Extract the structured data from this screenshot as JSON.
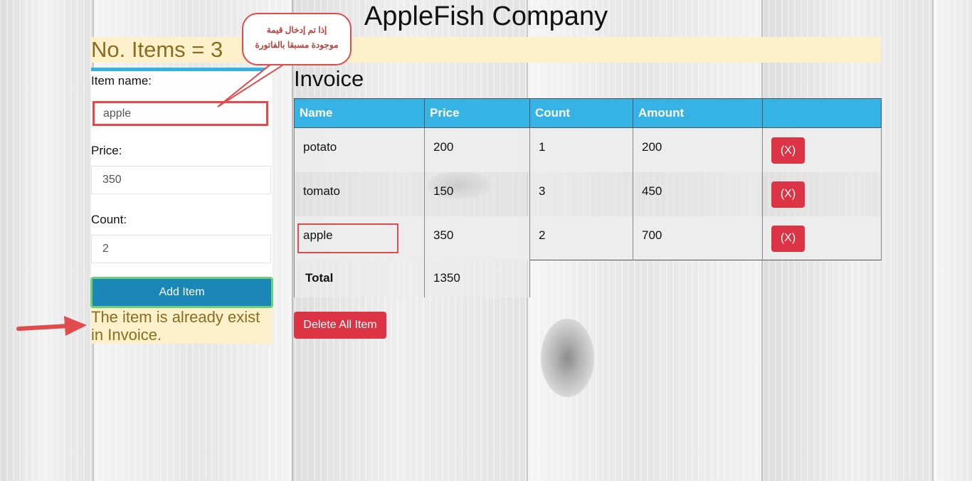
{
  "header": {
    "company_title": "AppleFish Company"
  },
  "items_count": "No. Items = 3",
  "form": {
    "item_name_label": "Item name:",
    "item_name_value": "apple",
    "price_label": "Price:",
    "price_value": "350",
    "count_label": "Count:",
    "count_value": "2",
    "add_button_label": "Add Item",
    "error_message": "The item is already exist in Invoice."
  },
  "invoice": {
    "heading": "Invoice",
    "columns": [
      "Name",
      "Price",
      "Count",
      "Amount",
      ""
    ],
    "rows": [
      {
        "name": "potato",
        "price": "200",
        "count": "1",
        "amount": "200",
        "remove_label": "(X)"
      },
      {
        "name": "tomato",
        "price": "150",
        "count": "3",
        "amount": "450",
        "remove_label": "(X)"
      },
      {
        "name": "apple",
        "price": "350",
        "count": "2",
        "amount": "700",
        "remove_label": "(X)"
      }
    ],
    "total_label": "Total",
    "total_value": "1350",
    "delete_all_label": "Delete All Item"
  },
  "annotation": {
    "callout_line1": "إذا تم إدخال قيمة",
    "callout_line2": "موجودة مسبقا بالفاتورة"
  },
  "colors": {
    "accent_blue": "#36b3e5",
    "button_blue": "#1a87b6",
    "danger_red": "#dc3444",
    "warning_bg": "#fdf1cc",
    "warning_text": "#8a6d1f",
    "annotation_red": "#e04b4b"
  }
}
